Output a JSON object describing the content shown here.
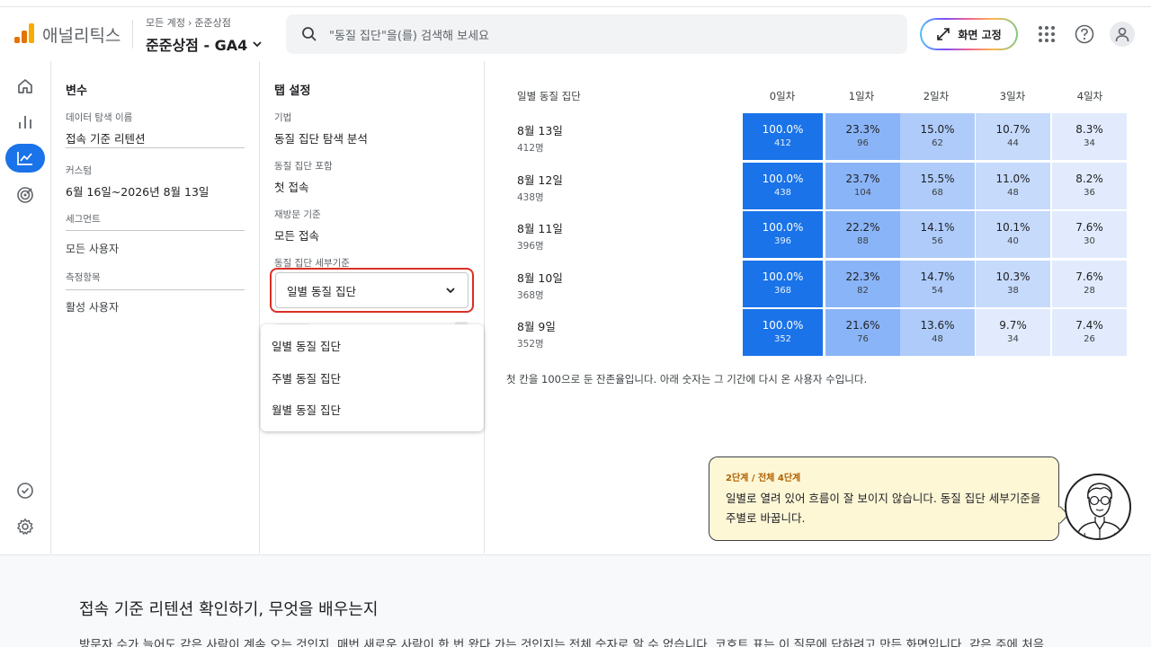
{
  "header": {
    "app_name": "애널리틱스",
    "breadcrumb": [
      "모든 계정",
      "준준상점"
    ],
    "property_name": "준준상점 - GA4",
    "search_placeholder": "\"동질 집단\"을(를) 검색해 보세요",
    "fix_button": "화면 고정"
  },
  "rail": {
    "items": [
      "home-icon",
      "reports-icon",
      "explore-icon",
      "advertising-icon"
    ],
    "active": "explore-icon",
    "bottom": [
      "admin-check-icon",
      "settings-icon"
    ]
  },
  "variables": {
    "title": "변수",
    "exploration_name_label": "데이터 탐색 이름",
    "exploration_name": "접속 기준 리텐션",
    "date_label": "커스텀",
    "date_range": "6월 16일~2026년 8월 13일",
    "segments_label": "세그먼트",
    "segment": "모든 사용자",
    "metrics_label": "측정항목",
    "metric": "활성 사용자"
  },
  "tab_settings": {
    "title": "탭 설정",
    "technique_label": "기법",
    "technique": "동질 집단 탐색 분석",
    "inclusion_label": "동질 집단 포함",
    "inclusion": "첫 접속",
    "return_label": "재방문 기준",
    "return": "모든 접속",
    "granularity_label": "동질 집단 세부기준",
    "granularity_value": "일별 동질 집단",
    "options": [
      "일별 동질 집단",
      "주별 동질 집단",
      "월별 동질 집단"
    ]
  },
  "table": {
    "header_label": "일별 동질 집단",
    "columns": [
      "0일차",
      "1일차",
      "2일차",
      "3일차",
      "4일차"
    ],
    "rows": [
      {
        "date": "8월 13일",
        "users": "412명",
        "cells": [
          {
            "pct": "100.0%",
            "n": "412"
          },
          {
            "pct": "23.3%",
            "n": "96"
          },
          {
            "pct": "15.0%",
            "n": "62"
          },
          {
            "pct": "10.7%",
            "n": "44"
          },
          {
            "pct": "8.3%",
            "n": "34"
          }
        ]
      },
      {
        "date": "8월 12일",
        "users": "438명",
        "cells": [
          {
            "pct": "100.0%",
            "n": "438"
          },
          {
            "pct": "23.7%",
            "n": "104"
          },
          {
            "pct": "15.5%",
            "n": "68"
          },
          {
            "pct": "11.0%",
            "n": "48"
          },
          {
            "pct": "8.2%",
            "n": "36"
          }
        ]
      },
      {
        "date": "8월 11일",
        "users": "396명",
        "cells": [
          {
            "pct": "100.0%",
            "n": "396"
          },
          {
            "pct": "22.2%",
            "n": "88"
          },
          {
            "pct": "14.1%",
            "n": "56"
          },
          {
            "pct": "10.1%",
            "n": "40"
          },
          {
            "pct": "7.6%",
            "n": "30"
          }
        ]
      },
      {
        "date": "8월 10일",
        "users": "368명",
        "cells": [
          {
            "pct": "100.0%",
            "n": "368"
          },
          {
            "pct": "22.3%",
            "n": "82"
          },
          {
            "pct": "14.7%",
            "n": "54"
          },
          {
            "pct": "10.3%",
            "n": "38"
          },
          {
            "pct": "7.6%",
            "n": "28"
          }
        ]
      },
      {
        "date": "8월 9일",
        "users": "352명",
        "cells": [
          {
            "pct": "100.0%",
            "n": "352"
          },
          {
            "pct": "21.6%",
            "n": "76"
          },
          {
            "pct": "13.6%",
            "n": "48"
          },
          {
            "pct": "9.7%",
            "n": "34"
          },
          {
            "pct": "7.4%",
            "n": "26"
          }
        ]
      }
    ],
    "note": "첫 칸을 100으로 둔 잔존율입니다. 아래 숫자는 그 기간에 다시 온 사용자 수입니다."
  },
  "heat_colors": {
    "level0": "#1a73e8",
    "level1": "#8ab4f8",
    "level2": "#aecbfa",
    "level3": "#c6dafc",
    "level4": "#e1ebfd"
  },
  "coach": {
    "step": "2단계 / 전체 4단계",
    "message": "일별로 열려 있어 흐름이 잘 보이지 않습니다. 동질 집단 세부기준을 주별로 바꿉니다."
  },
  "article": {
    "title": "접속 기준 리텐션 확인하기, 무엇을 배우는지",
    "body": "방문자 수가 늘어도 같은 사람이 계속 오는 것인지, 매번 새로운 사람이 한 번 왔다 가는 것인지는 전체 숫자로 알 수 없습니다. 코호트 표는 이 질문에 답하려고 만든 화면입니다. 같은 주에 처음"
  }
}
